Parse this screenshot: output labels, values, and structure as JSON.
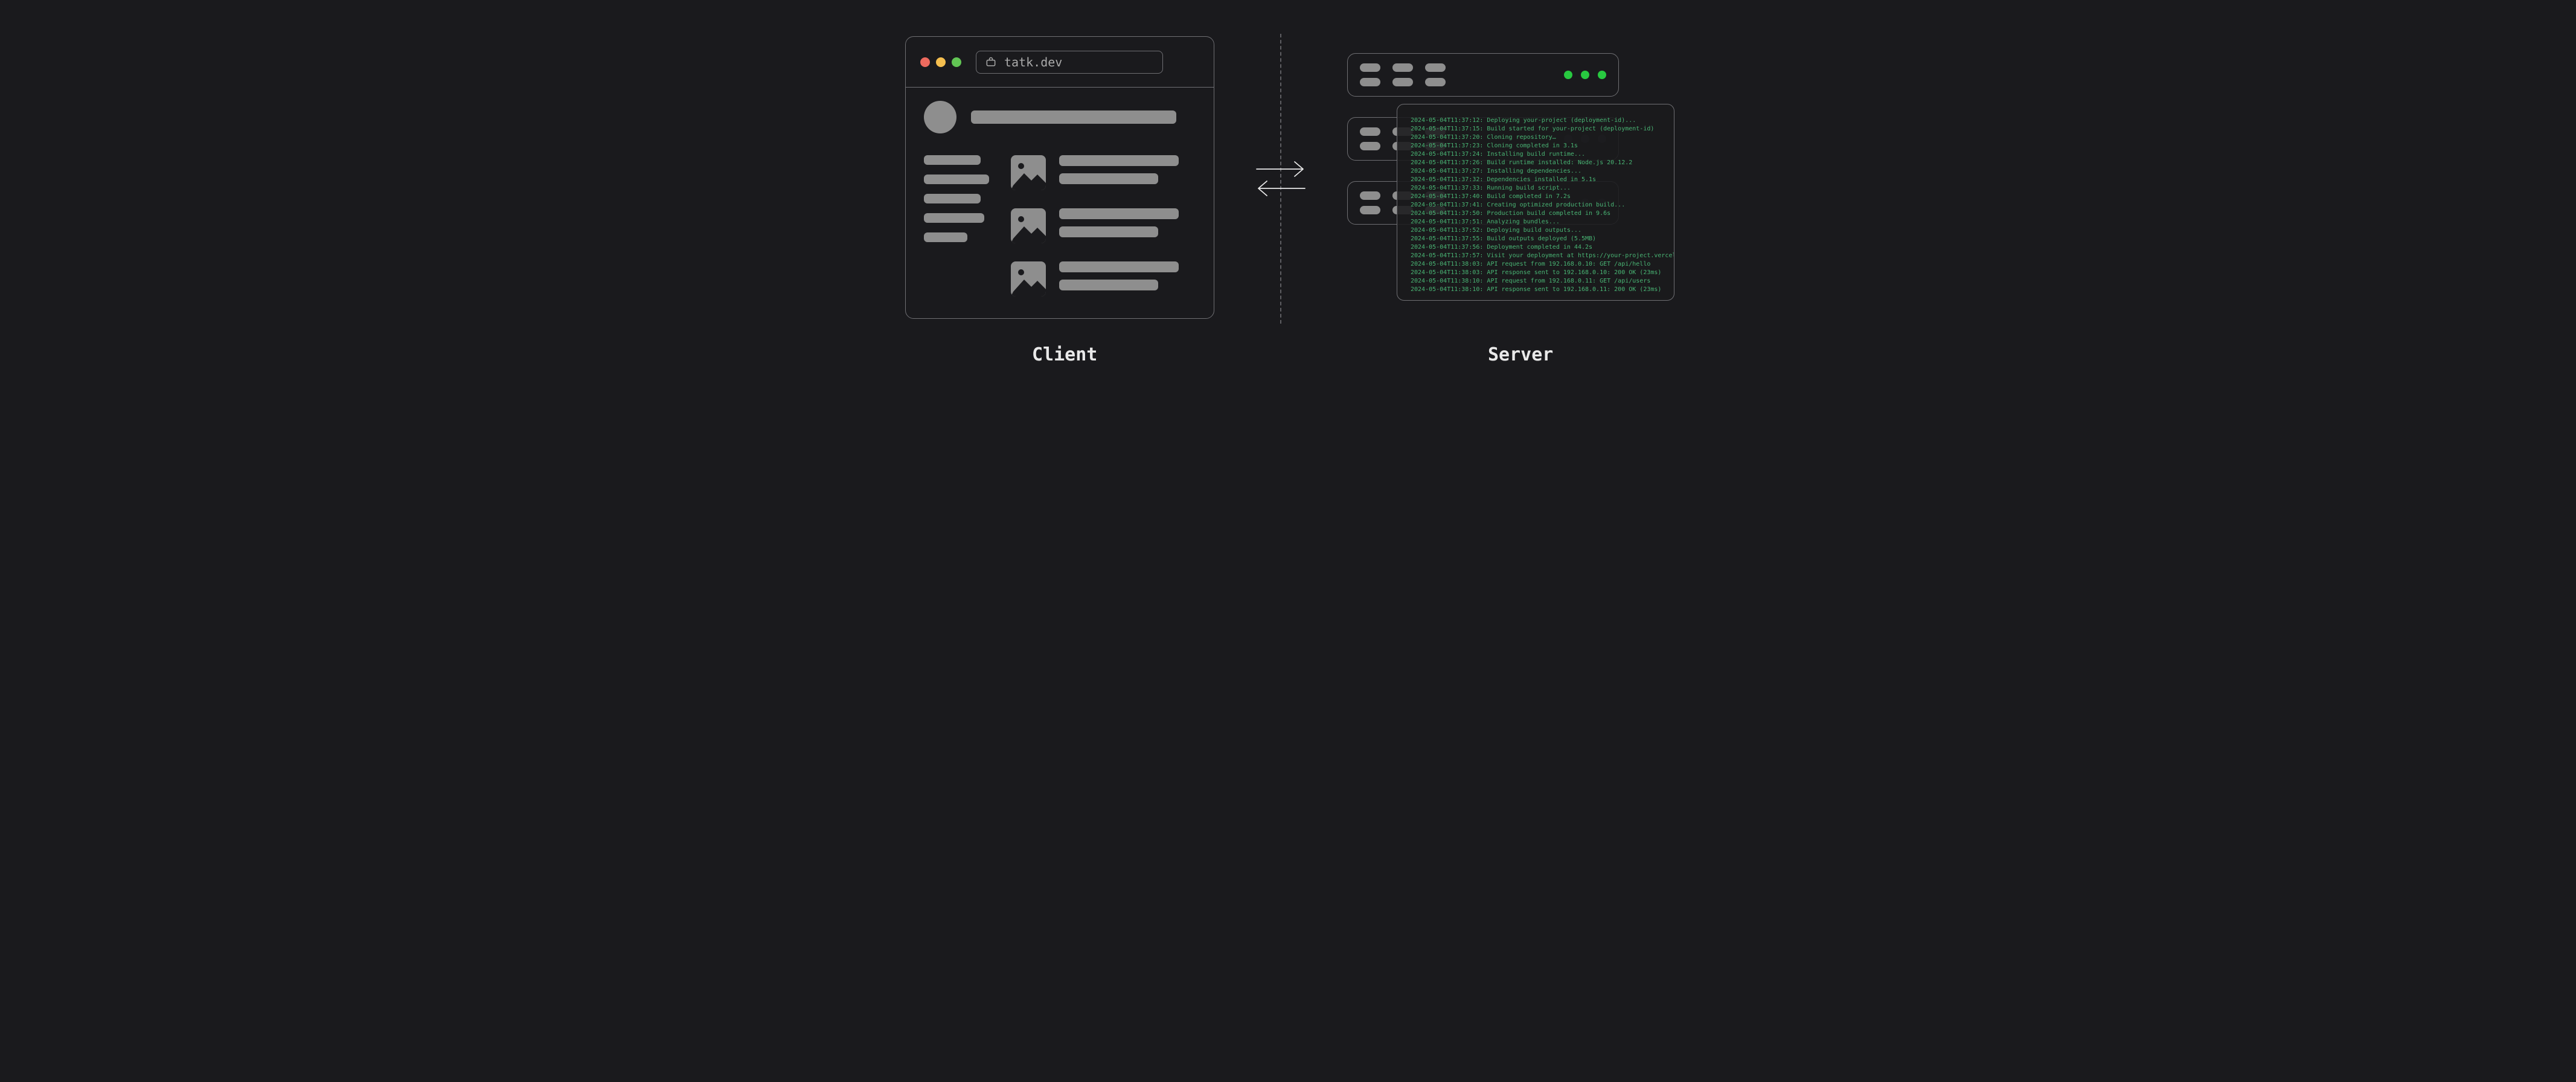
{
  "client": {
    "address": "tatk.dev"
  },
  "labels": {
    "client": "Client",
    "server": "Server"
  },
  "colors": {
    "traffic_red": "#ed6a5e",
    "traffic_yellow": "#f5bf4f",
    "traffic_green": "#62c554",
    "led_green": "#28c940",
    "terminal_text": "#49b574"
  },
  "terminal": {
    "lines": [
      "2024-05-04T11:37:12: Deploying your-project (deployment-id)...",
      "2024-05-04T11:37:15: Build started for your-project (deployment-id)",
      "2024-05-04T11:37:20: Cloning repository…",
      "2024-05-04T11:37:23: Cloning completed in 3.1s",
      "2024-05-04T11:37:24: Installing build runtime...",
      "2024-05-04T11:37:26: Build runtime installed: Node.js 20.12.2",
      "2024-05-04T11:37:27: Installing dependencies...",
      "2024-05-04T11:37:32: Dependencies installed in 5.1s",
      "2024-05-04T11:37:33: Running build script...",
      "2024-05-04T11:37:40: Build completed in 7.2s",
      "2024-05-04T11:37:41: Creating optimized production build...",
      "2024-05-04T11:37:50: Production build completed in 9.6s",
      "2024-05-04T11:37:51: Analyzing bundles...",
      "2024-05-04T11:37:52: Deploying build outputs...",
      "2024-05-04T11:37:55: Build outputs deployed (5.5MB)",
      "2024-05-04T11:37:56: Deployment completed in 44.2s",
      "2024-05-04T11:37:57: Visit your deployment at https://your-project.vercel.app",
      "2024-05-04T11:38:03: API request from 192.168.0.10: GET /api/hello",
      "2024-05-04T11:38:03: API response sent to 192.168.0.10: 200 OK (23ms)",
      "2024-05-04T11:38:10: API request from 192.168.0.11: GET /api/users",
      "2024-05-04T11:38:10: API response sent to 192.168.0.11: 200 OK (23ms)"
    ]
  }
}
